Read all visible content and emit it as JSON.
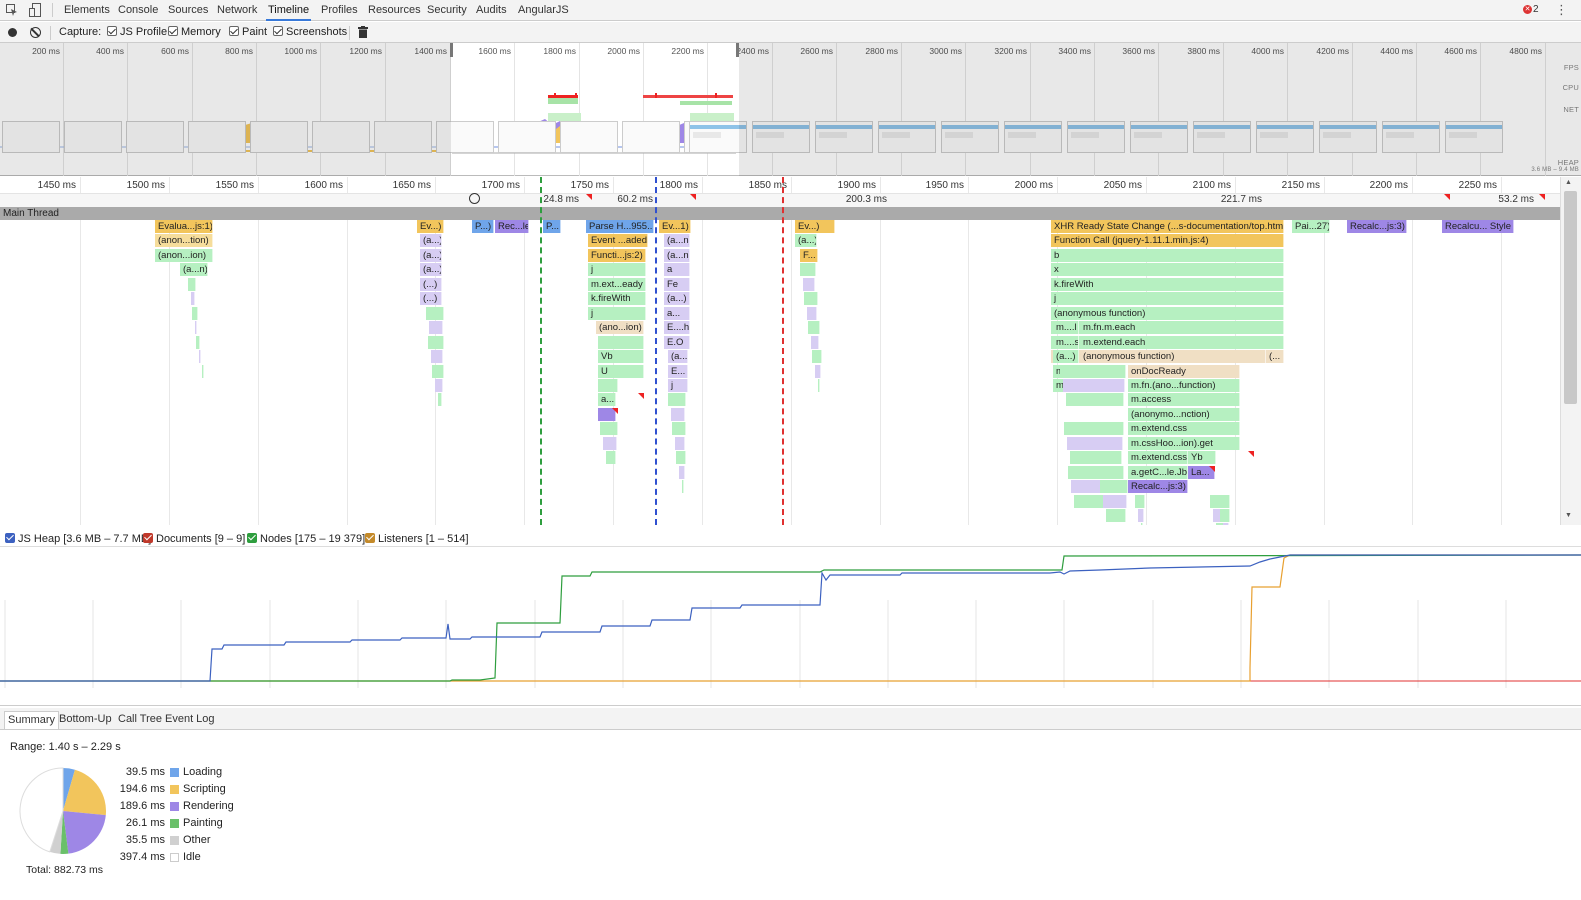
{
  "tabs": [
    "Elements",
    "Console",
    "Sources",
    "Network",
    "Timeline",
    "Profiles",
    "Resources",
    "Security",
    "Audits",
    "AngularJS"
  ],
  "active_tab": "Timeline",
  "error_count": "2",
  "toolbar": {
    "capture_label": "Capture:",
    "options": [
      {
        "label": "JS Profile",
        "checked": true
      },
      {
        "label": "Memory",
        "checked": true
      },
      {
        "label": "Paint",
        "checked": true
      },
      {
        "label": "Screenshots",
        "checked": true
      }
    ]
  },
  "overview": {
    "ticks": [
      "200 ms",
      "400 ms",
      "600 ms",
      "800 ms",
      "1000 ms",
      "1200 ms",
      "1400 ms",
      "1600 ms",
      "1800 ms",
      "2000 ms",
      "2200 ms",
      "2400 ms",
      "2600 ms",
      "2800 ms",
      "3000 ms",
      "3200 ms",
      "3400 ms",
      "3600 ms",
      "3800 ms",
      "4000 ms",
      "4200 ms",
      "4400 ms",
      "4600 ms",
      "4800 ms"
    ],
    "labels": {
      "fps": "FPS",
      "cpu": "CPU",
      "net": "NET",
      "heap": "HEAP",
      "heap_range": "3.6 MB – 9.4 MB"
    }
  },
  "flame_ruler": {
    "ticks": [
      "1450 ms",
      "1500 ms",
      "1550 ms",
      "1600 ms",
      "1650 ms",
      "1700 ms",
      "1750 ms",
      "1800 ms",
      "1850 ms",
      "1900 ms",
      "1950 ms",
      "2000 ms",
      "2050 ms",
      "2100 ms",
      "2150 ms",
      "2200 ms",
      "2250 ms"
    ],
    "frames": [
      "24.8 ms",
      "60.2 ms",
      "200.3 ms",
      "221.7 ms",
      "53.2 ms"
    ]
  },
  "main_thread_label": "Main Thread",
  "flame_labels": {
    "evaluate": "Evalua...js:1)",
    "anon1": "(anon...tion)",
    "anon2": "(anon...ion)",
    "an": "(a...n)",
    "ev": "Ev...)",
    "a": "(a...)",
    "dots": "(...)",
    "p": "P...)",
    "recale": "Rec...le",
    "p2": "P...",
    "parse": "Parse H...955...])",
    "event_loaded": "Event ...aded)",
    "functi": "Functi...js:2)",
    "j": "j",
    "m_ext_ready": "m.ext...eady",
    "k_firewith": "k.fireWith",
    "anon_ion": "(ano...ion)",
    "vb": "Vb",
    "u": "U",
    "a_dots": "a...",
    "ev1": "Ev...1)",
    "a_n": "(a...n)",
    "a_letter": "a",
    "fe": "Fe",
    "e_h": "E....h",
    "e_o": "E.O",
    "e_dots": "E...",
    "ev2": "Ev...)",
    "a_paren": "(a...)",
    "f_dots": "F...",
    "xhr": "XHR Ready State Change (...s-documentation/top.htm)",
    "function_call": "Function Call (jquery-1.11.1.min.js:4)",
    "b": "b",
    "x": "x",
    "anonymous_function": "(anonymous function)",
    "m_l": "m....l",
    "m_fn_m_each": "m.fn.m.each",
    "m_s": "m....s",
    "m_extend_each": "m.extend.each",
    "ondocready": "onDocReady",
    "m_dots": "m...",
    "m_fn_ano": "m.fn.(ano...function)",
    "m_access": "m.access",
    "anonymo_nction": "(anonymo...nction)",
    "m_extend_css": "m.extend.css",
    "m_csshoo_get": "m.cssHoo...ion).get",
    "yb": "Yb",
    "a_getc_jb": "a.getC...le.Jb",
    "la": "La...",
    "recalc_js3": "Recalc...js:3)",
    "pai_27": "Pai...27)",
    "recalc_js3b": "Recalc...js:3)",
    "recalcu_style": "Recalcu... Style",
    "ellipsis": "(...",
    "a_ellipsis": "(a...)"
  },
  "counters": [
    {
      "label": "JS Heap [3.6 MB – 7.7 MB]",
      "color": "#3c61c0"
    },
    {
      "label": "Documents [9 – 9]",
      "color": "#c0392b"
    },
    {
      "label": "Nodes [175 – 19 379]",
      "color": "#2e9e3e"
    },
    {
      "label": "Listeners [1 – 514]",
      "color": "#c48a2a"
    }
  ],
  "details_tabs": [
    "Summary",
    "Bottom-Up",
    "Call Tree",
    "Event Log"
  ],
  "active_details_tab": "Summary",
  "summary": {
    "range": "Range: 1.40 s – 2.29 s",
    "items": [
      {
        "value": "39.5 ms",
        "name": "Loading",
        "color": "#6fa5ea",
        "ms": 39.5
      },
      {
        "value": "194.6 ms",
        "name": "Scripting",
        "color": "#f2c55c",
        "ms": 194.6
      },
      {
        "value": "189.6 ms",
        "name": "Rendering",
        "color": "#9e87e6",
        "ms": 189.6
      },
      {
        "value": "26.1 ms",
        "name": "Painting",
        "color": "#6ac06a",
        "ms": 26.1
      },
      {
        "value": "35.5 ms",
        "name": "Other",
        "color": "#d0d0d0",
        "ms": 35.5
      },
      {
        "value": "397.4 ms",
        "name": "Idle",
        "color": "#ffffff",
        "ms": 397.4
      }
    ],
    "total": "Total: 882.73 ms"
  }
}
